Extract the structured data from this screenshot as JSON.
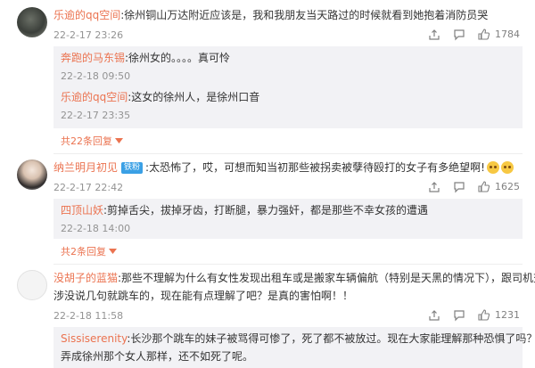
{
  "comments": [
    {
      "name": "乐逾的qq空间",
      "text": ":徐州铜山万达附近应该是，我和我朋友当天路过的时候就看到她抱着消防员哭",
      "time": "22-2-17 23:26",
      "likes": "1784",
      "replies": [
        {
          "name": "奔跑的马东锡",
          "text": ":徐州女的。。。。真可怜",
          "time": "22-2-18 09:50"
        },
        {
          "name": "乐逾的qq空间",
          "text": ":这女的徐州人，是徐州口音",
          "time": "22-2-17 23:35"
        }
      ],
      "more": "共22条回复"
    },
    {
      "name": "纳兰明月初见",
      "badge": "铁粉",
      "text": ":太恐怖了，哎，可想而知当初那些被拐卖被孽待殴打的女子有多绝望啊!",
      "time": "22-2-17 22:42",
      "likes": "1625",
      "replies": [
        {
          "name": "四顶山妖",
          "text": ":剪掉舌尖，拔掉牙齿，打断腿，暴力强奸，都是那些不幸女孩的遭遇",
          "time": "22-2-18 14:00"
        }
      ],
      "more": "共2条回复"
    },
    {
      "name": "没胡子的蓝猫",
      "text": ":那些不理解为什么有女性发现出租车或是搬家车辆偏航（特别是天黑的情况下），跟司机交",
      "text2": "涉没说几句就跳车的，现在能有点理解了吧？是真的害怕啊！！",
      "time": "22-2-18 11:58",
      "likes": "1231",
      "replies": [
        {
          "name": "Sissiserenity",
          "text": ":长沙那个跳车的妹子被骂得可惨了，死了都不被放过。现在大家能理解那种恐惧了吗？被",
          "text2": "弄成徐州那个女人那样，还不如死了呢。"
        }
      ]
    }
  ],
  "colors": {
    "name": "#eb7350",
    "meta": "#939393",
    "reply_bg": "#f2f2f5",
    "badge": "#3aa0e5"
  },
  "icons": [
    "share-icon",
    "comment-icon",
    "like-icon",
    "chevron-down-icon",
    "emoji-icon"
  ]
}
